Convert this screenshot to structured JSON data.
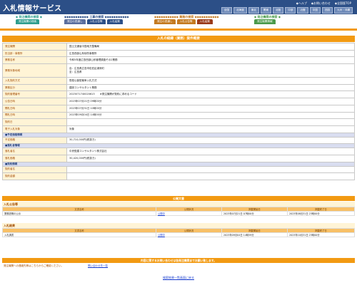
{
  "header": {
    "title": "入札情報サービス",
    "links": [
      "◆ヘルプ",
      "◆お問い合わせ",
      "◆全国版TOP"
    ],
    "regions": [
      "全国",
      "北海道",
      "東北",
      "関東",
      "北陸",
      "中部",
      "近畿",
      "中国",
      "四国",
      "九州・沖縄"
    ]
  },
  "nav": {
    "categories": [
      {
        "label": "◆ 発注機関の検索 ◆",
        "tabs": [
          {
            "label": "発注機関の検索",
            "color": "#2f9e8e"
          }
        ]
      },
      {
        "label": "◆◆◆◆◆◆◆◆◆◆◆ 工事の検索 ◆◆◆◆◆◆◆◆◆◆◆",
        "tabs": [
          {
            "label": "発注の見通し",
            "color": "#5a6e9e"
          },
          {
            "label": "入札公告等",
            "color": "#2c4f87"
          },
          {
            "label": "入札結果",
            "color": "#2c4f87"
          }
        ]
      },
      {
        "label": "◆◆◆◆◆◆◆◆◆◆◆ 業務の検索 ◆◆◆◆◆◆◆◆◆◆◆",
        "tabs": [
          {
            "label": "発注の見通し",
            "color": "#c47a20"
          },
          {
            "label": "入札公告等",
            "color": "#c47a20"
          },
          {
            "label": "入札結果",
            "color": "#9a3a1a"
          }
        ]
      },
      {
        "label": "◆ 発注機関の検索 ◆",
        "tabs": [
          {
            "label": "発注機関情報",
            "color": "#4a9a4a"
          }
        ]
      }
    ]
  },
  "detail": {
    "title": "入札の経緯（業務）案件概要",
    "rows": [
      {
        "key": "発注機関",
        "value": "国土交通省中国地方整備局"
      },
      {
        "key": "担当部・事務所",
        "value": "広島西部山系砂防事務所"
      },
      {
        "key": "業務名称",
        "value": "令和5年度広島西部山系管理調査その2業務"
      },
      {
        "key": "業務対象地域",
        "value": "自：広島県広島市佐伯区湯来町\n至：広島県",
        "tall": true
      },
      {
        "key": "入札契約方式",
        "value": "簡易公募型競争入札方式"
      },
      {
        "key": "業務区分",
        "value": "建設コンサルタント業務"
      },
      {
        "key": "契約管理番号",
        "value": "2023071740020613　　★発注機関が契約に求めるコード"
      },
      {
        "key": "公告日時",
        "value": "2023年07月21日 09時00分"
      },
      {
        "key": "開札日時",
        "value": "2023年07月31日 10時00分"
      },
      {
        "key": "開札日時",
        "value": "2023年09月04日 14時00分"
      },
      {
        "key": "契約日",
        "value": ""
      },
      {
        "key": "電子入札対象",
        "value": "対象"
      },
      {
        "section": "■予定価格情報"
      },
      {
        "key": "予定価格",
        "value": "30,710,000円(税抜き)"
      },
      {
        "section": "■落札者情報"
      },
      {
        "key": "落札者名",
        "value": "中央復建コンサルタンツ株式会社"
      },
      {
        "key": "落札価格",
        "value": "30,420,000円(税抜き)"
      },
      {
        "section": "■契約情報"
      },
      {
        "key": "契約者名",
        "value": ""
      },
      {
        "key": "契約金額",
        "value": ""
      }
    ]
  },
  "documents": {
    "title": "公開文書",
    "groups": [
      {
        "name": "入札公告等",
        "headers": [
          "文書名称",
          "公開状況",
          "掲載開始日",
          "掲載終了日"
        ],
        "rows": [
          [
            "業務説明の公示",
            "公開中",
            "2023年07月21日 07時00分",
            "2023年08月31日 23時00分"
          ]
        ]
      },
      {
        "name": "入札結果",
        "headers": [
          "文書名称",
          "公開状況",
          "掲載開始日",
          "掲載終了日"
        ],
        "rows": [
          [
            "入札調書",
            "公開中",
            "2023年09月04日 14時59分",
            "2023年10月31日 23時00分"
          ]
        ]
      }
    ]
  },
  "contact": {
    "bar": "内容に関するお問い合わせは各発注機関までお願い致します。",
    "label": "発注機関への連絡先等はこちらからご確認ください。",
    "link": "問い合わせ先一覧"
  },
  "footer": {
    "back": "検索結果一覧画面に戻る"
  }
}
